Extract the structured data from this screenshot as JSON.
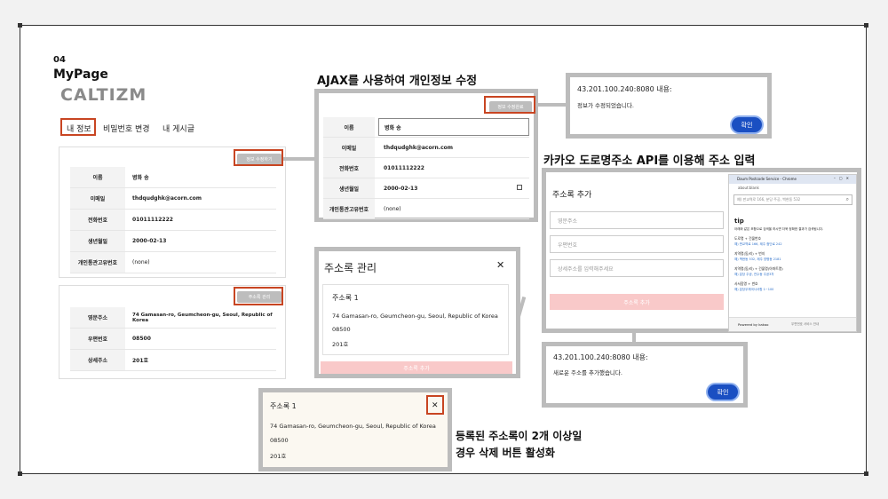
{
  "slide": {
    "number": "04",
    "title": "MyPage",
    "brand": "CALTIZM"
  },
  "mypage": {
    "tabs": [
      "내 정보",
      "비밀번호 변경",
      "내 게시글"
    ],
    "info_button": "정보 수정하기",
    "info_rows": [
      {
        "label": "이름",
        "value": "병화 송"
      },
      {
        "label": "이메일",
        "value": "thdqudghk@acorn.com"
      },
      {
        "label": "전화번호",
        "value": "01011112222"
      },
      {
        "label": "생년월일",
        "value": "2000-02-13"
      },
      {
        "label": "개인통관고유번호",
        "value": "(none)"
      }
    ],
    "address_button": "주소록 관리",
    "address_rows": [
      {
        "label": "영문주소",
        "value": "74 Gamasan-ro, Geumcheon-gu, Seoul, Republic of Korea"
      },
      {
        "label": "우편번호",
        "value": "08500"
      },
      {
        "label": "상세주소",
        "value": "201호"
      }
    ]
  },
  "ajax_section": {
    "heading": "AJAX를 사용하여 개인정보 수정",
    "button": "정보 수정완료",
    "rows": [
      {
        "label": "이름",
        "value": "병화 송"
      },
      {
        "label": "이메일",
        "value": "thdqudghk@acorn.com"
      },
      {
        "label": "전화번호",
        "value": "01011112222"
      },
      {
        "label": "생년월일",
        "value": "2000-02-13"
      },
      {
        "label": "개인통관고유번호",
        "value": "(none)"
      }
    ]
  },
  "alert_update": {
    "host": "43.201.100.240:8080 내용:",
    "message": "정보가 수정되었습니다.",
    "ok": "확인"
  },
  "address_modal": {
    "title": "주소록 관리",
    "close": "✕",
    "entry_title": "주소록 1",
    "entry_address": "74 Gamasan-ro, Geumcheon-gu, Seoul, Republic of Korea",
    "entry_zip": "08500",
    "entry_detail": "201호",
    "add_button": "주소록 추가"
  },
  "kakao_section": {
    "heading": "카카오 도로명주소 API를 이용해 주소 입력",
    "form_title": "주소록 추가",
    "placeholder_en": "영문주소",
    "placeholder_zip": "우편번호",
    "placeholder_detail": "상세주소를 입력해주세요",
    "add_button": "주소록 추가",
    "popup": {
      "window_title": "Daum Postcode Service - Chrome",
      "url": "about:blank",
      "search_placeholder": "예) 판교역로 166, 분당 주공, 백현동 532",
      "tip_title": "tip",
      "tip_desc": "아래와 같은 조합으로 검색을 하시면 더욱 정확한 결과가 검색됩니다.",
      "tips": [
        {
          "head": "도로명 + 건물번호",
          "example": "예) 판교역로 166, 제주 첨단로 242"
        },
        {
          "head": "지역명(동/리) + 번지",
          "example": "예) 백현동 532, 제주 영평동 2181"
        },
        {
          "head": "지역명(동/리) + 건물명(아파트명)",
          "example": "예) 분당 주공, 연수동 주공3차"
        },
        {
          "head": "사서함명 + 번호",
          "example": "예) 분당우체국사서함 1~100"
        }
      ],
      "footer_brand": "Powered by kakao",
      "footer_links": "우편번호 서비스 안내"
    }
  },
  "alert_add": {
    "host": "43.201.100.240:8080 내용:",
    "message": "새로운 주소를 추가했습니다.",
    "ok": "확인"
  },
  "delete_card": {
    "entry_title": "주소록 1",
    "close": "✕",
    "entry_address": "74 Gamasan-ro, Geumcheon-gu, Seoul, Republic of Korea",
    "entry_zip": "08500",
    "entry_detail": "201호"
  },
  "delete_note": {
    "line1": "등록된 주소록이 2개 이상일",
    "line2": "경우 삭제 버튼 활성화"
  },
  "colors": {
    "accent_red": "#c84522",
    "frame_gray": "#bcbcbc",
    "ok_blue": "#1a4fc2",
    "add_pink": "#f9c9c9"
  }
}
